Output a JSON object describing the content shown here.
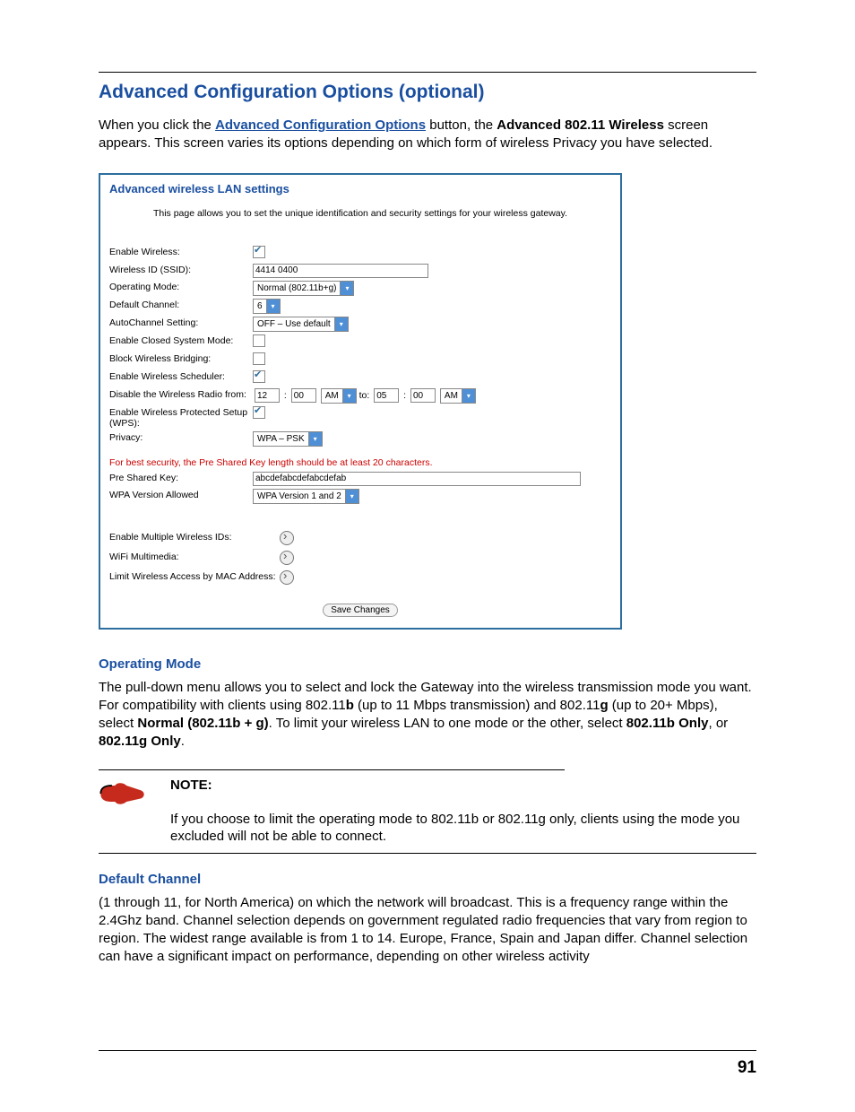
{
  "header": {
    "title": "Advanced Configuration Options (optional)",
    "intro_pre": "When you click the ",
    "intro_link": "Advanced Configuration Options",
    "intro_mid": " button, the ",
    "intro_bold": "Advanced 802.11 Wireless",
    "intro_post": " screen appears. This screen varies its options depending on which form of wireless Privacy you have selected."
  },
  "panel": {
    "title": "Advanced wireless LAN settings",
    "desc": "This page allows you to set the unique identification and security settings for your wireless gateway.",
    "labels": {
      "enable_wireless": "Enable Wireless:",
      "ssid": "Wireless ID (SSID):",
      "op_mode": "Operating Mode:",
      "def_channel": "Default Channel:",
      "autoch": "AutoChannel Setting:",
      "closed": "Enable Closed System Mode:",
      "block_bridge": "Block Wireless Bridging:",
      "scheduler": "Enable Wireless Scheduler:",
      "disable_radio": "Disable the Wireless Radio from:",
      "wps": "Enable Wireless Protected Setup (WPS):",
      "privacy": "Privacy:",
      "psk": "Pre Shared Key:",
      "wpa_ver": "WPA Version Allowed",
      "multi_ssid": "Enable Multiple Wireless IDs:",
      "wmm": "WiFi Multimedia:",
      "mac_limit": "Limit Wireless Access by MAC Address:"
    },
    "values": {
      "ssid": "4414 0400",
      "op_mode": "Normal (802.11b+g)",
      "def_channel": "6",
      "autoch": "OFF – Use default",
      "from_h": "12",
      "from_m": "00",
      "from_ampm": "AM",
      "to_label": "to:",
      "to_h": "05",
      "to_m": "00",
      "to_ampm": "AM",
      "privacy": "WPA – PSK",
      "psk": "abcdefabcdefabcdefab",
      "wpa_ver": "WPA Version 1 and 2"
    },
    "warning": "For best security, the Pre Shared Key length should be at least 20 characters.",
    "save_button": "Save Changes"
  },
  "operating_mode": {
    "title": "Operating Mode",
    "p1a": "The pull-down menu allows you to select and lock the Gateway into the wireless transmission mode you want. For compatibility with clients using 802.11",
    "p1b": "b",
    "p1c": " (up to 11 Mbps transmission) and 802.11",
    "p1d": "g",
    "p1e": " (up to 20+ Mbps), select ",
    "p1f": "Normal (802.11b + g)",
    "p1g": ". To limit your wireless LAN to one mode or the other, select ",
    "p1h": "802.11b Only",
    "p1i": ", or ",
    "p1j": "802.11g Only",
    "p1k": "."
  },
  "note": {
    "label": "NOTE:",
    "text": "If you choose to limit the operating mode to 802.11b or 802.11g only, clients using the mode you excluded will not be able to connect."
  },
  "default_channel": {
    "title": "Default Channel",
    "text": "(1 through 11, for North America) on which the network will broadcast. This is a frequency range within the 2.4Ghz band. Channel selection depends on government regulated radio frequencies that vary from region to region. The widest range available is from 1 to 14. Europe, France, Spain and Japan differ. Channel selection can have a significant impact on performance, depending on other wireless activity"
  },
  "page_number": "91"
}
